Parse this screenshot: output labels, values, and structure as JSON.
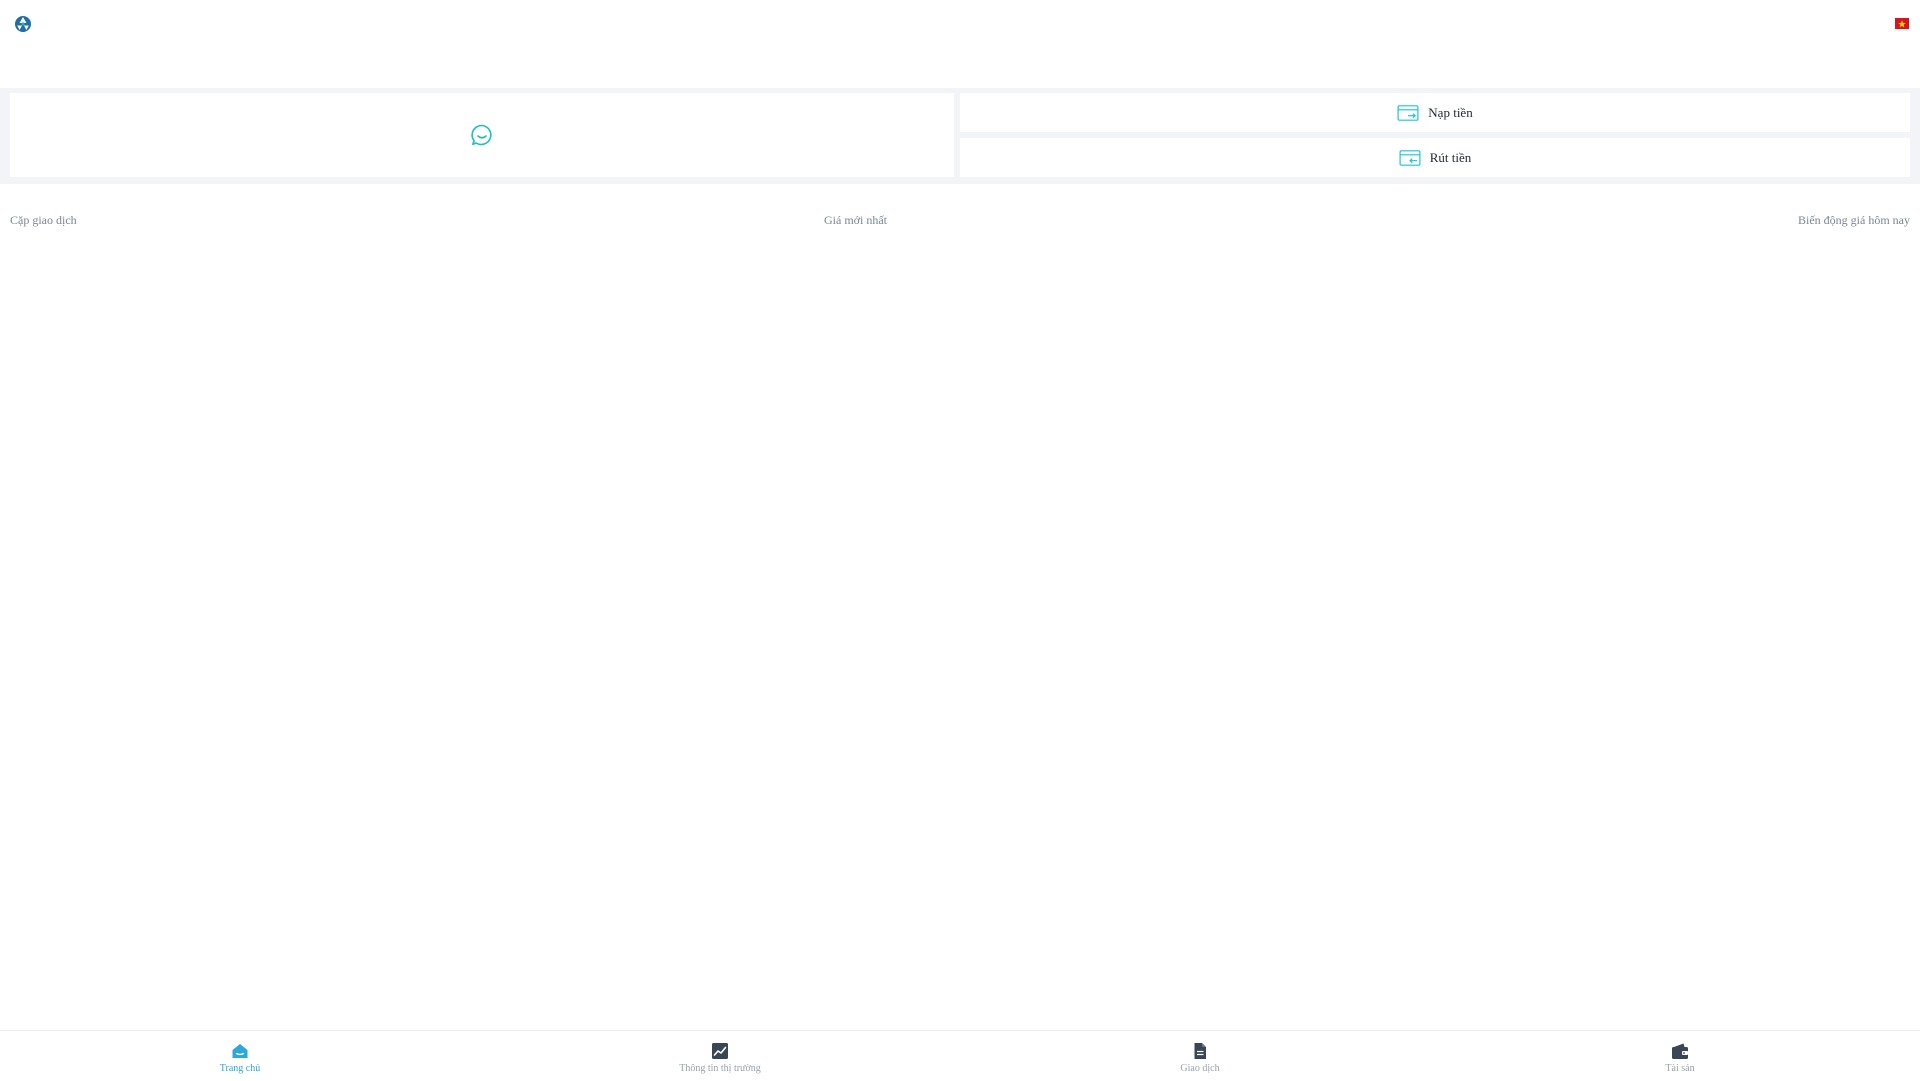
{
  "header": {
    "logo_icon": "brand-logo-icon",
    "language_flag_icon": "vietnam-flag-icon"
  },
  "actions": {
    "chat_icon": "chat-bubble-icon",
    "deposit_label": "Nạp tiền",
    "withdraw_label": "Rút tiền"
  },
  "market_table": {
    "columns": [
      "Cặp giao dịch",
      "Giá mới nhất",
      "Biến động giá hôm nay"
    ]
  },
  "bottom_nav": {
    "items": [
      {
        "label": "Trang chủ",
        "icon": "home-icon",
        "active": true
      },
      {
        "label": "Thông tin thị trường",
        "icon": "market-chart-icon",
        "active": false
      },
      {
        "label": "Giao dịch",
        "icon": "document-icon",
        "active": false
      },
      {
        "label": "Tài sản",
        "icon": "wallet-icon",
        "active": false
      }
    ]
  },
  "colors": {
    "accent": "#2da8d8",
    "chat_icon": "#19c4b0",
    "nav_icon": "#3a4656",
    "nav_label": "#9aa2ac",
    "band_background": "#f2f4f8",
    "flag_red": "#d8141c",
    "flag_star": "#ffde00"
  }
}
